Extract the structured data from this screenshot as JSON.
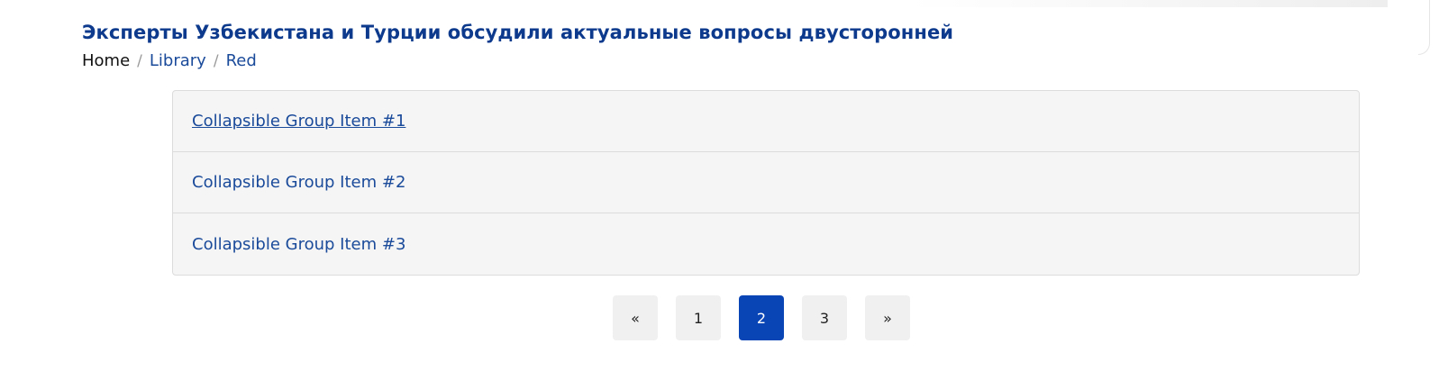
{
  "header": {
    "title": "Эксперты Узбекистана и Турции обсудили актуальные вопросы двусторонней"
  },
  "breadcrumb": {
    "home": "Home",
    "separator": "/",
    "library": "Library",
    "current": "Red"
  },
  "accordion": {
    "items": [
      {
        "label": "Collapsible Group Item #1"
      },
      {
        "label": "Collapsible Group Item #2"
      },
      {
        "label": "Collapsible Group Item #3"
      }
    ]
  },
  "pagination": {
    "prev": "«",
    "pages": [
      "1",
      "2",
      "3"
    ],
    "active_page": "2",
    "next": "»"
  },
  "colors": {
    "title": "#0d3a8c",
    "link": "#1a4a9a",
    "active_page_bg": "#0a45b5",
    "panel_bg": "#f5f5f5"
  }
}
